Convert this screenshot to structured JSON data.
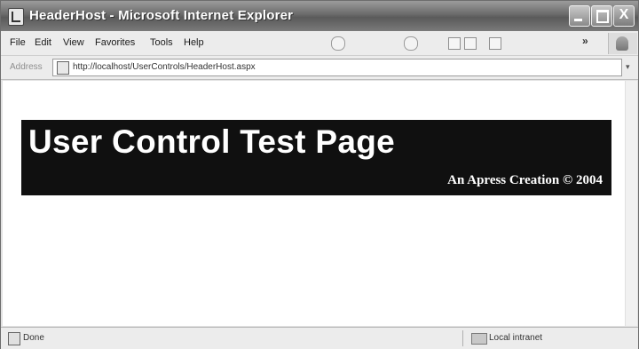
{
  "window": {
    "title": "HeaderHost - Microsoft Internet Explorer",
    "close_glyph": "X"
  },
  "menu": {
    "items": [
      "File",
      "Edit",
      "View",
      "Favorites",
      "Tools",
      "Help"
    ],
    "more_glyph": "»"
  },
  "address": {
    "label": "Address",
    "url": "http://localhost/UserControls/HeaderHost.aspx",
    "dropdown_glyph": "▾"
  },
  "content": {
    "header_title": "User Control Test Page",
    "header_subtitle": "An Apress Creation © 2004"
  },
  "status": {
    "text": "Done",
    "zone": "Local intranet"
  }
}
